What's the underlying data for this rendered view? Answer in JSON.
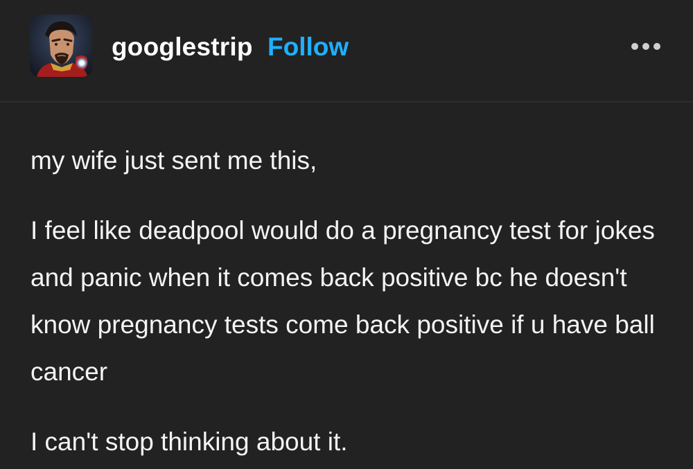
{
  "header": {
    "username": "googlestrip",
    "follow_label": "Follow",
    "avatar_icon": "tony-stark-avatar",
    "more_icon": "more-dots-icon"
  },
  "post": {
    "paragraphs": [
      "my wife just sent me this,",
      "I feel like deadpool would do a pregnancy test for jokes and panic when it comes back positive bc he doesn't know pregnancy tests come back positive if u have ball cancer",
      "I can't stop thinking about it."
    ]
  },
  "colors": {
    "background": "#222222",
    "text": "#ffffff",
    "follow": "#1fb0ff",
    "divider": "#2e2e2e"
  }
}
